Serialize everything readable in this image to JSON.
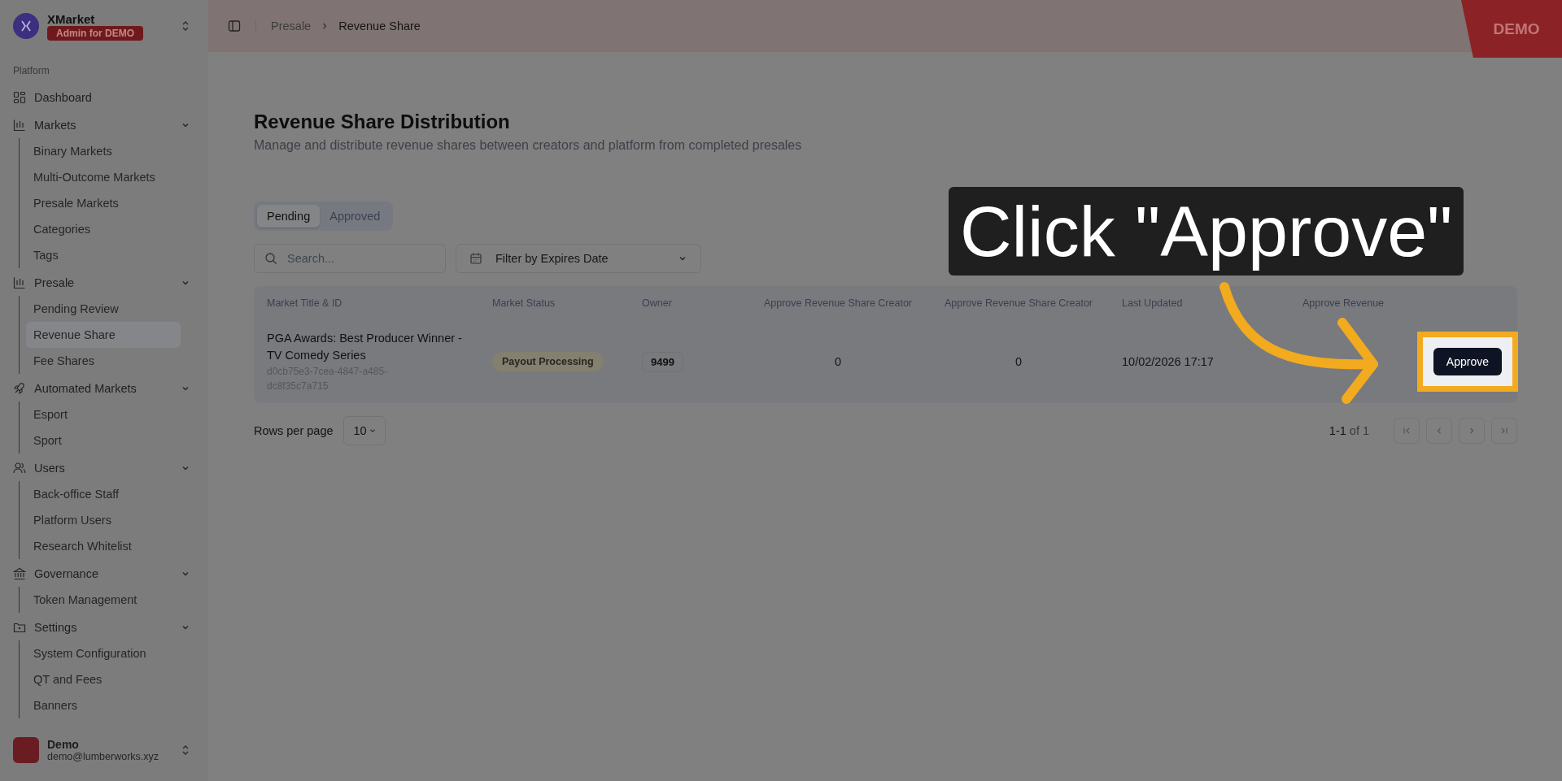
{
  "brand": {
    "name": "XMarket",
    "badge": "Admin for DEMO"
  },
  "sidebar": {
    "section_label": "Platform",
    "groups": [
      {
        "label": "Dashboard"
      },
      {
        "label": "Markets",
        "expanded": true,
        "children": [
          {
            "label": "Binary Markets",
            "selected": false
          },
          {
            "label": "Multi-Outcome Markets",
            "selected": false
          },
          {
            "label": "Presale Markets",
            "selected": false
          },
          {
            "label": "Categories",
            "selected": false
          },
          {
            "label": "Tags",
            "selected": false
          }
        ]
      },
      {
        "label": "Presale",
        "expanded": true,
        "children": [
          {
            "label": "Pending Review",
            "selected": false
          },
          {
            "label": "Revenue Share",
            "selected": true
          },
          {
            "label": "Fee Shares",
            "selected": false
          }
        ]
      },
      {
        "label": "Automated Markets",
        "expanded": true,
        "children": [
          {
            "label": "Esport",
            "selected": false
          },
          {
            "label": "Sport",
            "selected": false
          }
        ]
      },
      {
        "label": "Users",
        "expanded": true,
        "children": [
          {
            "label": "Back-office Staff",
            "selected": false
          },
          {
            "label": "Platform Users",
            "selected": false
          },
          {
            "label": "Research Whitelist",
            "selected": false
          }
        ]
      },
      {
        "label": "Governance",
        "expanded": true,
        "children": [
          {
            "label": "Token Management",
            "selected": false
          }
        ]
      },
      {
        "label": "Settings",
        "expanded": true,
        "children": [
          {
            "label": "System Configuration",
            "selected": false
          },
          {
            "label": "QT and Fees",
            "selected": false
          },
          {
            "label": "Banners",
            "selected": false
          }
        ]
      }
    ]
  },
  "user": {
    "name": "Demo",
    "email": "demo@lumberworks.xyz"
  },
  "breadcrumb": [
    "Presale",
    "Revenue Share"
  ],
  "env_ribbon": "DEMO",
  "page": {
    "title": "Revenue Share Distribution",
    "subtitle": "Manage and distribute revenue shares between creators and platform from completed presales"
  },
  "tabs": [
    {
      "label": "Pending",
      "selected": true
    },
    {
      "label": "Approved",
      "selected": false
    }
  ],
  "search": {
    "placeholder": "Search..."
  },
  "date_filter": {
    "label": "Filter by Expires Date"
  },
  "table": {
    "columns": [
      "Market Title & ID",
      "Market Status",
      "Owner",
      "Approve Revenue Share Creator",
      "Approve Revenue Share Creator",
      "Last Updated",
      "Approve Revenue"
    ],
    "rows": [
      {
        "title": "PGA Awards: Best Producer Winner - TV Comedy Series",
        "id": "d0cb75e3-7cea-4847-a485-dc8f35c7a715",
        "status": "Payout Processing",
        "owner": "9499",
        "creator_share_1": "0",
        "creator_share_2": "0",
        "last_updated": "10/02/2026 17:17",
        "action": "Approve"
      }
    ]
  },
  "pagination": {
    "rows_per_page_label": "Rows per page",
    "rows_per_page": "10",
    "range": "1-1",
    "of": "of 1"
  },
  "callout": {
    "text": "Click \"Approve\""
  }
}
